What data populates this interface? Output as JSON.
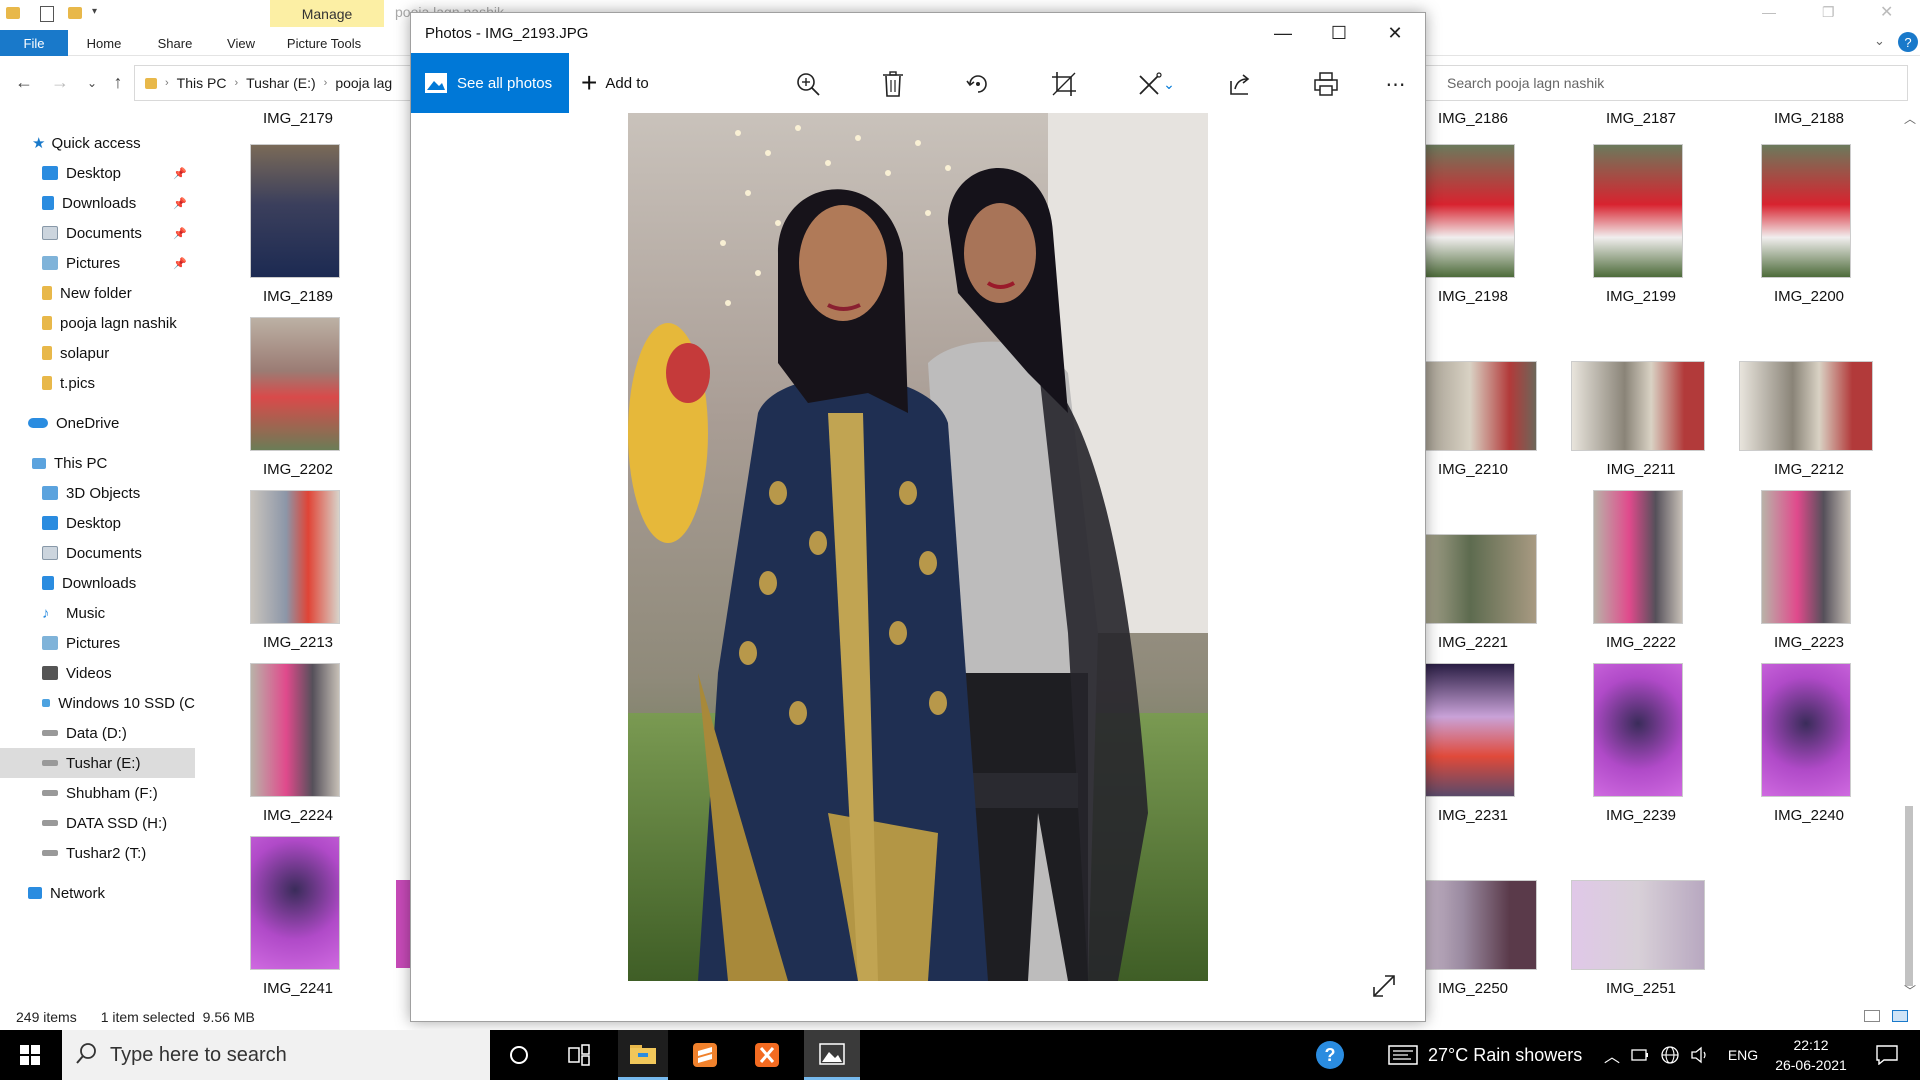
{
  "explorer": {
    "window_title": "pooja lagn nashik",
    "manage_tab": "Manage",
    "ribbon_tabs": [
      "File",
      "Home",
      "Share",
      "View",
      "Picture Tools"
    ],
    "address": {
      "this_pc": "This PC",
      "drive": "Tushar (E:)",
      "folder": "pooja lag"
    },
    "search_placeholder": "Search pooja lagn nashik"
  },
  "nav": {
    "quick_access": "Quick access",
    "qa_items": [
      "Desktop",
      "Downloads",
      "Documents",
      "Pictures",
      "New folder",
      "pooja lagn nashik",
      "solapur",
      "t.pics"
    ],
    "onedrive": "OneDrive",
    "this_pc": "This PC",
    "pc_items": [
      "3D Objects",
      "Desktop",
      "Documents",
      "Downloads",
      "Music",
      "Pictures",
      "Videos",
      "Windows 10 SSD (C",
      "Data (D:)",
      "Tushar (E:)",
      "Shubham (F:)",
      "DATA SSD (H:)",
      "Tushar2 (T:)"
    ],
    "network": "Network"
  },
  "files": {
    "left_col": [
      "IMG_2179",
      "IMG_2189",
      "IMG_2202",
      "IMG_2213",
      "IMG_2224",
      "IMG_2241"
    ],
    "right_cols": [
      [
        "IMG_2186",
        "IMG_2187",
        "IMG_2188"
      ],
      [
        "IMG_2198",
        "IMG_2199",
        "IMG_2200"
      ],
      [
        "IMG_2210",
        "IMG_2211",
        "IMG_2212"
      ],
      [
        "IMG_2221",
        "IMG_2222",
        "IMG_2223"
      ],
      [
        "IMG_2231",
        "IMG_2239",
        "IMG_2240"
      ],
      [
        "IMG_2250",
        "IMG_2251",
        ""
      ]
    ]
  },
  "status": {
    "count": "249 items",
    "selected": "1 item selected",
    "size": "9.56 MB"
  },
  "photos": {
    "title": "Photos - IMG_2193.JPG",
    "see_all": "See all photos",
    "add_to": "Add to",
    "icons": [
      "zoom-in-icon",
      "delete-icon",
      "rotate-icon",
      "crop-icon",
      "edit-icon",
      "share-icon",
      "print-icon",
      "more-icon"
    ]
  },
  "taskbar": {
    "search_placeholder": "Type here to search",
    "weather": "27°C  Rain showers",
    "lang": "ENG",
    "time": "22:12",
    "date": "26-06-2021"
  },
  "colors": {
    "accent": "#0078d7",
    "file_tab": "#1979ca",
    "manage_tab": "#fcefa4"
  }
}
